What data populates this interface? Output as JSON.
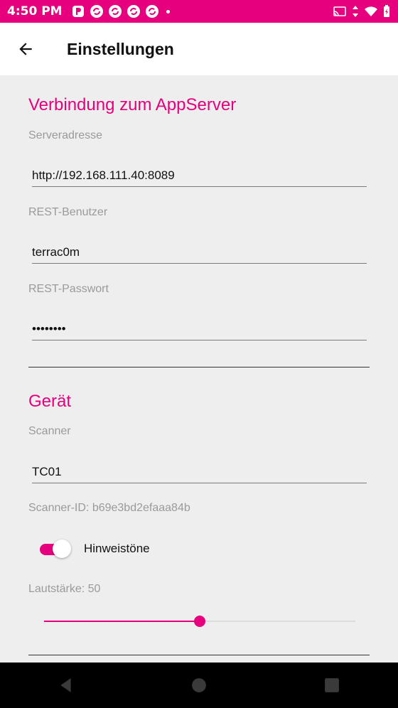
{
  "status_bar": {
    "time": "4:50 PM",
    "accent": "#e6007e",
    "icons_left": [
      "app-notification-icon",
      "sync-icon",
      "sync-icon",
      "sync-icon",
      "sync-icon"
    ],
    "icons_right": [
      "cast-icon",
      "data-arrows-icon",
      "wifi-icon",
      "battery-charging-icon"
    ]
  },
  "app_bar": {
    "title": "Einstellungen",
    "back_icon": "arrow-back-icon"
  },
  "server_section": {
    "title": "Verbindung zum AppServer",
    "address_label": "Serveradresse",
    "address_value": "http://192.168.111.40:8089",
    "user_label": "REST-Benutzer",
    "user_value": "terrac0m",
    "password_label": "REST-Passwort",
    "password_value": "••••••••"
  },
  "device_section": {
    "title": "Gerät",
    "scanner_label": "Scanner",
    "scanner_value": "TC01",
    "scanner_id": "Scanner-ID: b69e3bd2efaaa84b",
    "sounds_label": "Hinweistöne",
    "sounds_enabled": true,
    "volume_label": "Lautstärke: 50",
    "volume_value": 50,
    "volume_max": 100
  },
  "nav_bar": {
    "back_icon": "nav-back-icon",
    "home_icon": "nav-home-icon",
    "recents_icon": "nav-recents-icon"
  }
}
